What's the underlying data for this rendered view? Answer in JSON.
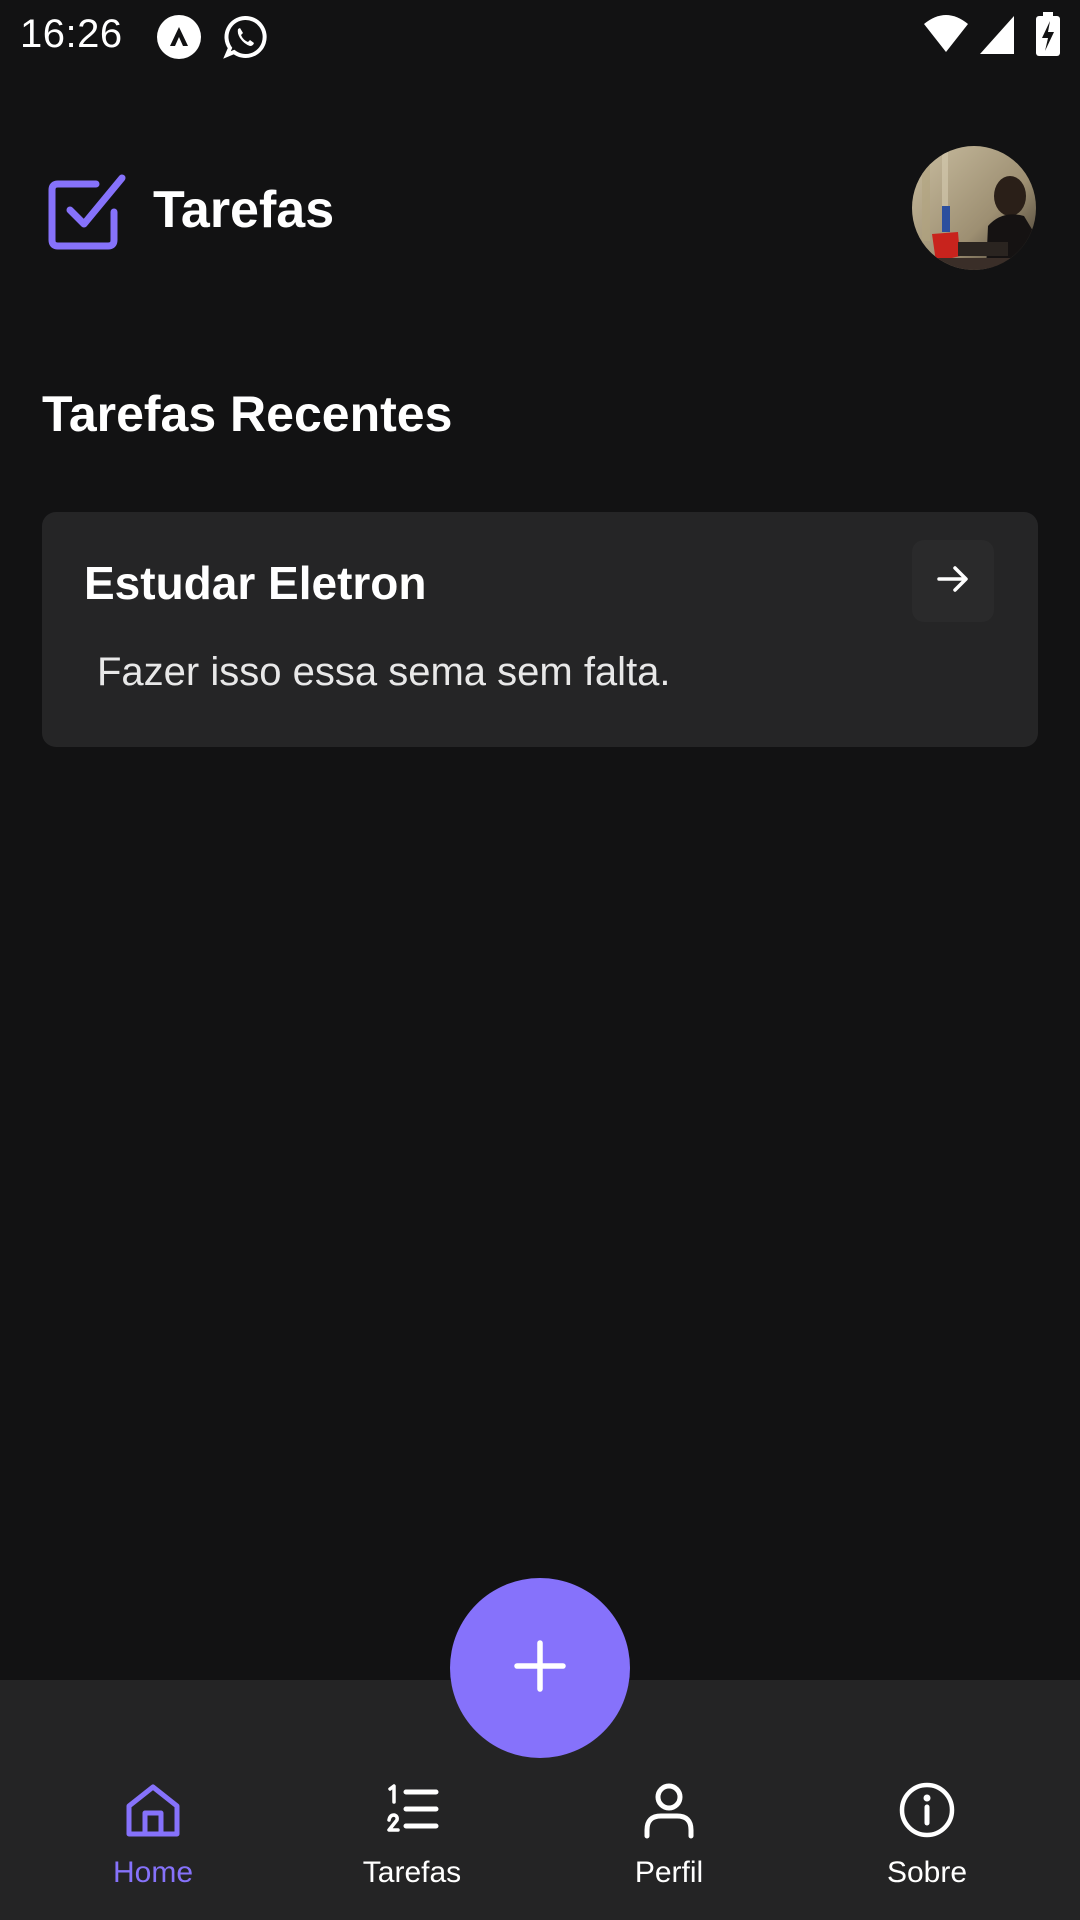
{
  "status_bar": {
    "time": "16:26",
    "icons": [
      "app-notification-icon",
      "whatsapp-icon",
      "wifi-icon",
      "signal-icon",
      "battery-charging-icon"
    ]
  },
  "header": {
    "title": "Tarefas",
    "logo_icon": "checkbox-icon",
    "avatar": "user-avatar"
  },
  "main": {
    "section_title": "Tarefas Recentes",
    "tasks": [
      {
        "title": "Estudar Eletron",
        "description": "Fazer isso essa sema sem falta.",
        "action_icon": "arrow-right-icon"
      }
    ]
  },
  "fab": {
    "icon": "plus-icon"
  },
  "bottom_nav": {
    "items": [
      {
        "label": "Home",
        "icon": "home-icon",
        "active": true
      },
      {
        "label": "Tarefas",
        "icon": "list-icon",
        "active": false
      },
      {
        "label": "Perfil",
        "icon": "user-icon",
        "active": false
      },
      {
        "label": "Sobre",
        "icon": "info-icon",
        "active": false
      }
    ]
  },
  "colors": {
    "background": "#121213",
    "surface": "#252526",
    "nav_background": "#242425",
    "accent": "#8672fb",
    "text": "#ffffff"
  }
}
